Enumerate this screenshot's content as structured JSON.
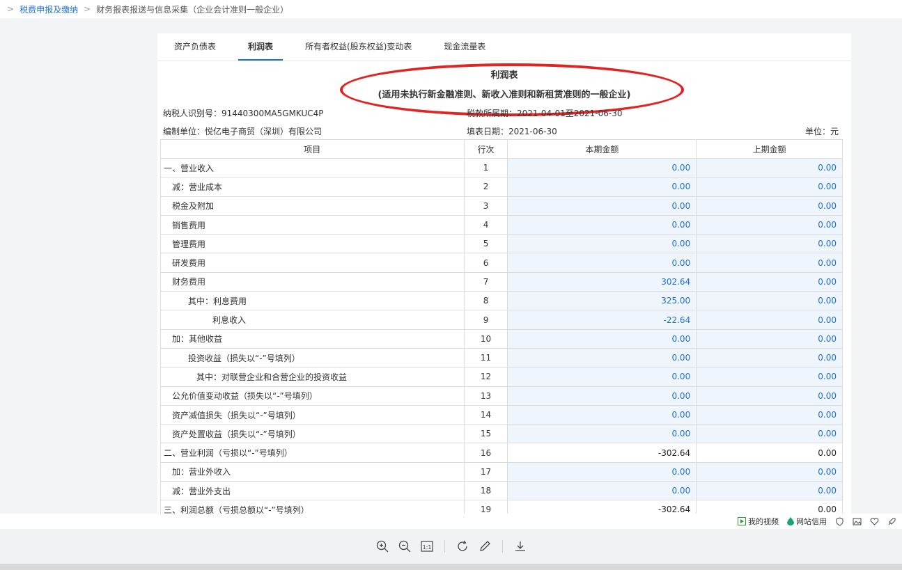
{
  "breadcrumb": {
    "root": "税费申报及缴纳",
    "current": "财务报表报送与信息采集（企业会计准则一般企业）"
  },
  "tabs": [
    {
      "label": "资产负债表"
    },
    {
      "label": "利润表"
    },
    {
      "label": "所有者权益(股东权益)变动表"
    },
    {
      "label": "现金流量表"
    }
  ],
  "report": {
    "title": "利润表",
    "subtitle": "(适用未执行新金融准则、新收入准则和新租赁准则的一般企业)",
    "taxpayer_id": "纳税人识别号：91440300MA5GMKUC4P",
    "tax_period": "税款所属期：2021-04-01至2021-06-30",
    "company": "编制单位：悦亿电子商贸（深圳）有限公司",
    "fill_date": "填表日期：2021-06-30",
    "unit": "单位：元"
  },
  "table": {
    "headers": [
      "项目",
      "行次",
      "本期金额",
      "上期金额"
    ],
    "rows": [
      {
        "item": "一、营业收入",
        "line": "1",
        "current": "0.00",
        "previous": "0.00"
      },
      {
        "item": "减：营业成本",
        "line": "2",
        "current": "0.00",
        "previous": "0.00"
      },
      {
        "item": "税金及附加",
        "line": "3",
        "current": "0.00",
        "previous": "0.00"
      },
      {
        "item": "销售费用",
        "line": "4",
        "current": "0.00",
        "previous": "0.00"
      },
      {
        "item": "管理费用",
        "line": "5",
        "current": "0.00",
        "previous": "0.00"
      },
      {
        "item": "研发费用",
        "line": "6",
        "current": "0.00",
        "previous": "0.00"
      },
      {
        "item": "财务费用",
        "line": "7",
        "current": "302.64",
        "previous": "0.00"
      },
      {
        "item": "其中：利息费用",
        "line": "8",
        "current": "325.00",
        "previous": "0.00"
      },
      {
        "item": "利息收入",
        "line": "9",
        "current": "-22.64",
        "previous": "0.00"
      },
      {
        "item": "加：其他收益",
        "line": "10",
        "current": "0.00",
        "previous": "0.00"
      },
      {
        "item": "投资收益（损失以“-”号填列）",
        "line": "11",
        "current": "0.00",
        "previous": "0.00"
      },
      {
        "item": "其中：对联营企业和合营企业的投资收益",
        "line": "12",
        "current": "0.00",
        "previous": "0.00"
      },
      {
        "item": "公允价值变动收益（损失以“-”号填列）",
        "line": "13",
        "current": "0.00",
        "previous": "0.00"
      },
      {
        "item": "资产减值损失（损失以“-”号填列）",
        "line": "14",
        "current": "0.00",
        "previous": "0.00"
      },
      {
        "item": "资产处置收益（损失以“-”号填列）",
        "line": "15",
        "current": "0.00",
        "previous": "0.00"
      },
      {
        "item": "二、营业利润（亏损以“-”号填列）",
        "line": "16",
        "current": "-302.64",
        "previous": "0.00"
      },
      {
        "item": "加：营业外收入",
        "line": "17",
        "current": "0.00",
        "previous": "0.00"
      },
      {
        "item": "减：营业外支出",
        "line": "18",
        "current": "0.00",
        "previous": "0.00"
      },
      {
        "item": "三、利润总额（亏损总额以“-”号填列）",
        "line": "19",
        "current": "-302.64",
        "previous": "0.00"
      }
    ]
  },
  "status_bar": {
    "my_video": "我的视频",
    "site_credit": "网站信用"
  },
  "colors": {
    "accent": "#1f6fd1",
    "input_cell_bg": "#eef5fd",
    "annotation_red": "#e02424"
  }
}
